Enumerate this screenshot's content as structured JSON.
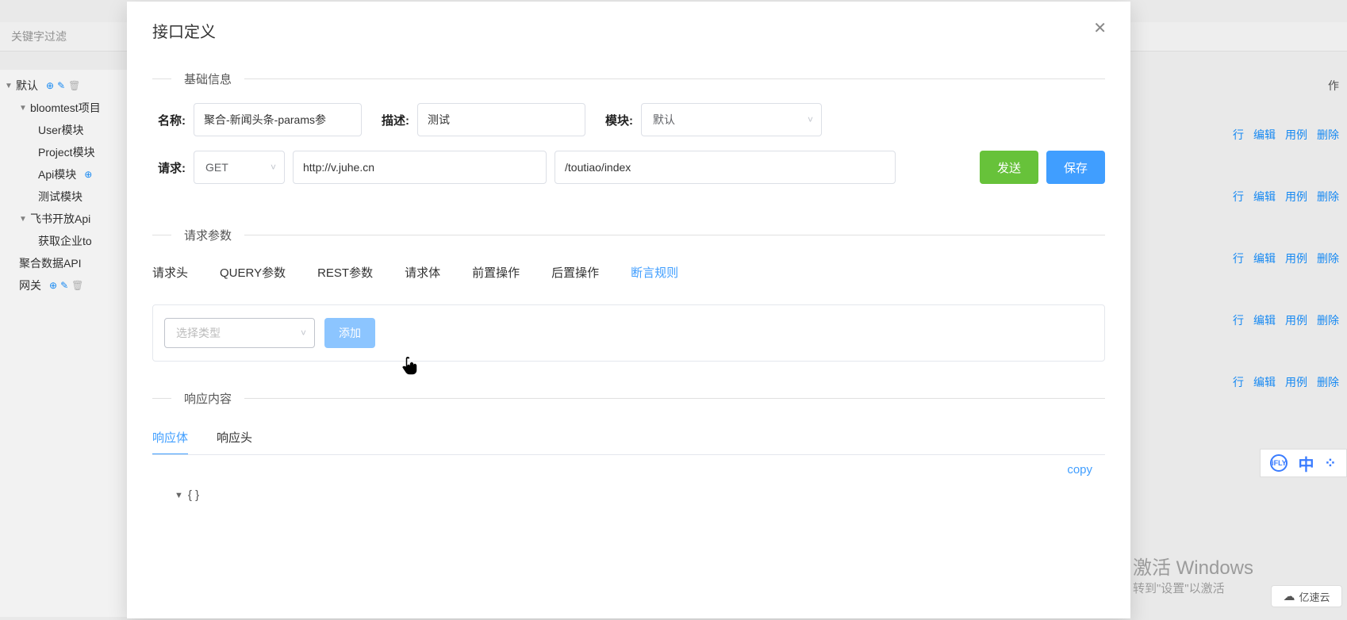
{
  "bg": {
    "filter_placeholder": "关键字过滤",
    "tree": [
      {
        "level": 0,
        "label": "默认",
        "caret": true,
        "icons": [
          "add",
          "edit",
          "del"
        ]
      },
      {
        "level": 1,
        "label": "bloomtest项目",
        "caret": true
      },
      {
        "level": 2,
        "label": "User模块"
      },
      {
        "level": 2,
        "label": "Project模块"
      },
      {
        "level": 2,
        "label": "Api模块"
      },
      {
        "level": 2,
        "label": "测试模块"
      },
      {
        "level": 1,
        "label": "飞书开放Api",
        "caret": true
      },
      {
        "level": 2,
        "label": "获取企业to"
      },
      {
        "level": 1,
        "label": "聚合数据API"
      },
      {
        "level": 1,
        "label": "网关",
        "icons": [
          "add",
          "edit",
          "del"
        ]
      }
    ],
    "header_action": "作",
    "row_actions": [
      "行",
      "编辑",
      "用例",
      "删除"
    ]
  },
  "modal": {
    "title": "接口定义",
    "sections": {
      "basic": "基础信息",
      "params": "请求参数",
      "response": "响应内容"
    },
    "basic_form": {
      "name_label": "名称:",
      "name_value": "聚合-新闻头条-params参",
      "desc_label": "描述:",
      "desc_value": "测试",
      "module_label": "模块:",
      "module_value": "默认",
      "req_label": "请求:",
      "method_value": "GET",
      "host_value": "http://v.juhe.cn",
      "path_value": "/toutiao/index",
      "send_btn": "发送",
      "save_btn": "保存"
    },
    "param_tabs": [
      "请求头",
      "QUERY参数",
      "REST参数",
      "请求体",
      "前置操作",
      "后置操作",
      "断言规则"
    ],
    "param_active_tab": 6,
    "assert_box": {
      "type_placeholder": "选择类型",
      "add_btn": "添加"
    },
    "resp_tabs": [
      "响应体",
      "响应头"
    ],
    "resp_active_tab": 0,
    "copy_text": "copy",
    "json_root": "{ }"
  },
  "overlay": {
    "win1": "激活 Windows",
    "win2": "转到\"设置\"以激活",
    "ime_zh": "中",
    "ime_ifly": "iFLY",
    "cloud_label": "亿速云"
  }
}
